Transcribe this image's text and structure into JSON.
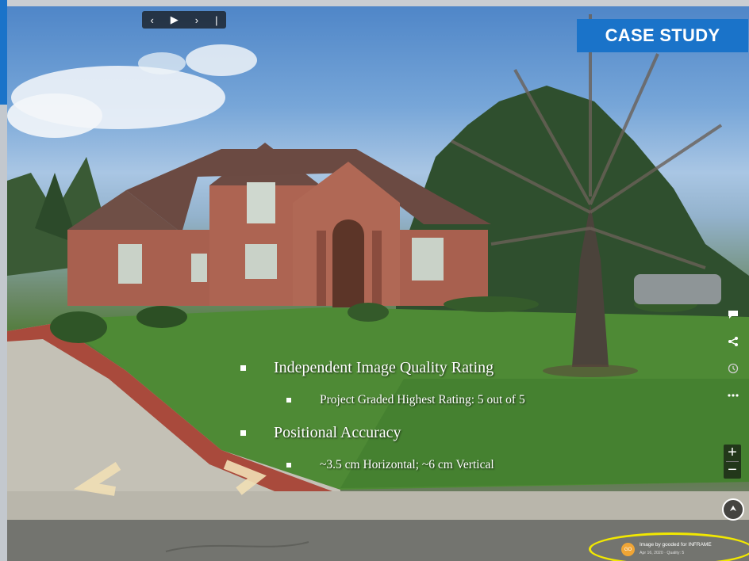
{
  "badge": {
    "label": "CASE STUDY"
  },
  "controls": {
    "prev": "‹",
    "play": "▶",
    "next": "›",
    "divider": "|"
  },
  "bullets": [
    {
      "level": 1,
      "text": "Independent Image Quality Rating"
    },
    {
      "level": 2,
      "text": "Project Graded Highest Rating:  5 out of 5"
    },
    {
      "level": 1,
      "text": "Positional Accuracy"
    },
    {
      "level": 2,
      "text": "~3.5 cm Horizontal; ~6 cm Vertical"
    }
  ],
  "zoom": {
    "plus": "+",
    "minus": "−"
  },
  "attribution": {
    "avatar_initials": "GO",
    "line1": "Image by gooded for INFRAME",
    "line2": "Apr 16, 2020 · Quality: 5"
  },
  "colors": {
    "accent": "#1a73c9",
    "highlight": "#f2e800"
  }
}
